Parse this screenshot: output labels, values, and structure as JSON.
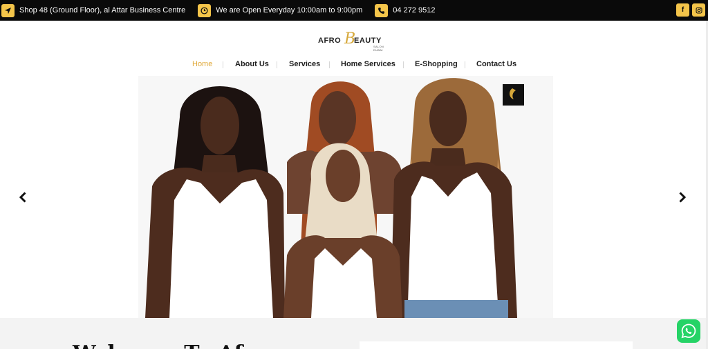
{
  "topbar": {
    "address": "Shop 48 (Ground Floor), al Attar Business Centre",
    "hours": "We are Open Everyday 10:00am to 9:00pm",
    "phone": "04 272 9512",
    "social": [
      {
        "icon": "facebook-icon",
        "label": "f"
      },
      {
        "icon": "instagram-icon",
        "label": ""
      }
    ],
    "accent": "#f4c54a"
  },
  "logo": {
    "word1": "AFRO",
    "letter": "B",
    "word2": "EAUTY",
    "subtitle": "SALON DUBAI"
  },
  "nav": {
    "items": [
      {
        "label": "Home",
        "active": true
      },
      {
        "label": "About Us",
        "active": false
      },
      {
        "label": "Services",
        "active": false
      },
      {
        "label": "Home Services",
        "active": false
      },
      {
        "label": "E-Shopping",
        "active": false
      },
      {
        "label": "Contact Us",
        "active": false
      }
    ],
    "active_color": "#e0a93a"
  },
  "hero": {
    "prev_icon": "chevron-left-icon",
    "next_icon": "chevron-right-icon"
  },
  "bottom": {
    "heading": "Welcome To Afro"
  },
  "whatsapp": {
    "icon": "whatsapp-icon",
    "color": "#25d366"
  }
}
